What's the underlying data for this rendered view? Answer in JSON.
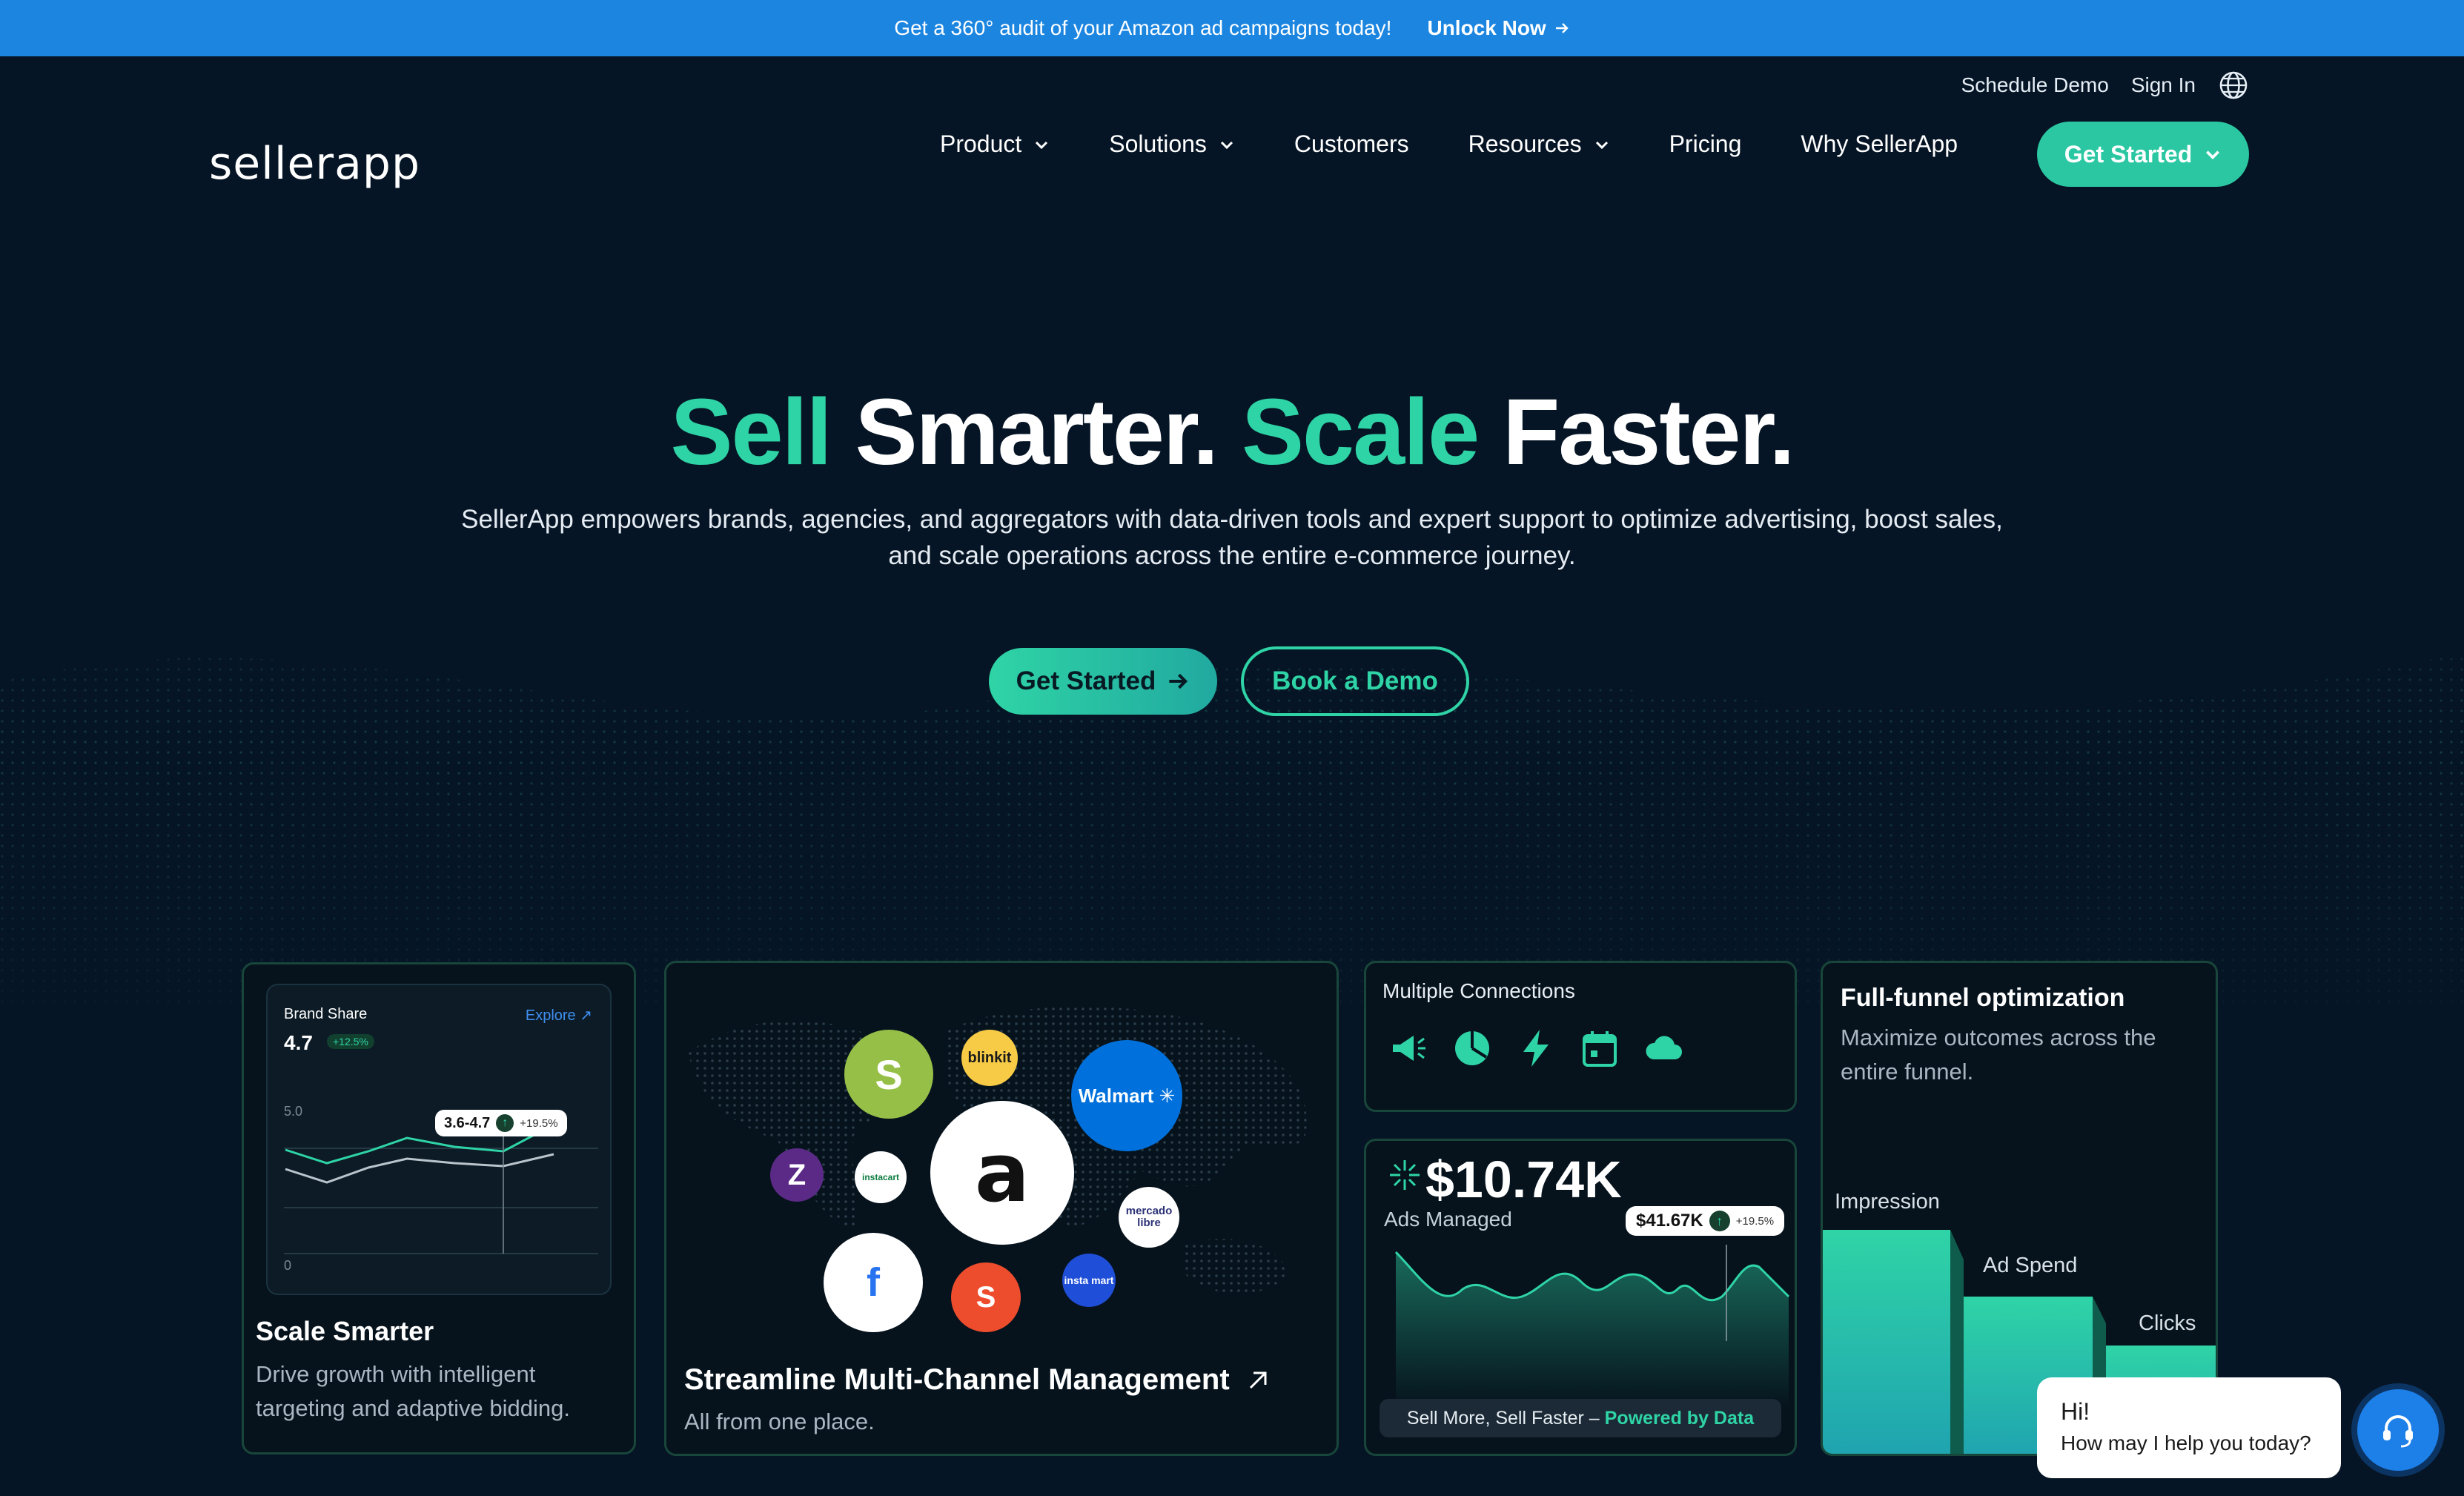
{
  "banner": {
    "text": "Get a 360° audit of your Amazon ad campaigns today!",
    "cta": "Unlock Now"
  },
  "header": {
    "schedule_demo": "Schedule Demo",
    "sign_in": "Sign In",
    "logo": "sellerapp",
    "nav": [
      {
        "label": "Product",
        "dropdown": true
      },
      {
        "label": "Solutions",
        "dropdown": true
      },
      {
        "label": "Customers",
        "dropdown": false
      },
      {
        "label": "Resources",
        "dropdown": true
      },
      {
        "label": "Pricing",
        "dropdown": false
      },
      {
        "label": "Why SellerApp",
        "dropdown": false
      }
    ],
    "cta": "Get Started"
  },
  "hero": {
    "title_part1": "Sell",
    "title_part2": "Smarter.",
    "title_part3": "Scale",
    "title_part4": "Faster.",
    "subtitle": "SellerApp empowers brands, agencies, and aggregators with data-driven tools and expert support to optimize advertising, boost sales, and scale operations across the entire e-commerce journey.",
    "primary_cta": "Get Started",
    "secondary_cta": "Book a Demo"
  },
  "cards": {
    "scale": {
      "chart_label": "Brand Share",
      "chart_value": "4.7",
      "chart_badge": "+12.5%",
      "explore": "Explore",
      "tick_top": "5.0",
      "tick_bottom": "0",
      "tooltip_range": "3.6-4.7",
      "tooltip_pct": "+19.5%",
      "title": "Scale Smarter",
      "desc": "Drive growth with intelligent targeting and adaptive bidding."
    },
    "multichannel": {
      "title": "Streamline Multi-Channel Management",
      "desc": "All from one place.",
      "logos": [
        "Shopify",
        "blinkit",
        "Walmart",
        "amazon",
        "Zepto",
        "instacart",
        "mercado libre",
        "Flipkart",
        "Shopee",
        "instamart"
      ]
    },
    "connections": {
      "title": "Multiple Connections",
      "icons": [
        "megaphone-icon",
        "pie-chart-icon",
        "lightning-icon",
        "calendar-icon",
        "cloud-icon"
      ]
    },
    "ads": {
      "value": "$10.74K",
      "label": "Ads Managed",
      "tooltip_value": "$41.67K",
      "tooltip_pct": "+19.5%",
      "pill_text": "Sell More, Sell Faster –",
      "pill_bold": "Powered by Data"
    },
    "funnel": {
      "title": "Full-funnel optimization",
      "desc": "Maximize outcomes across the entire funnel.",
      "stages": [
        "Impression",
        "Ad Spend",
        "Clicks"
      ]
    }
  },
  "chat": {
    "greeting": "Hi!",
    "message": "How may I help you today?"
  },
  "colors": {
    "background": "#061525",
    "banner": "#1b85e0",
    "accent": "#2fd4a6"
  }
}
